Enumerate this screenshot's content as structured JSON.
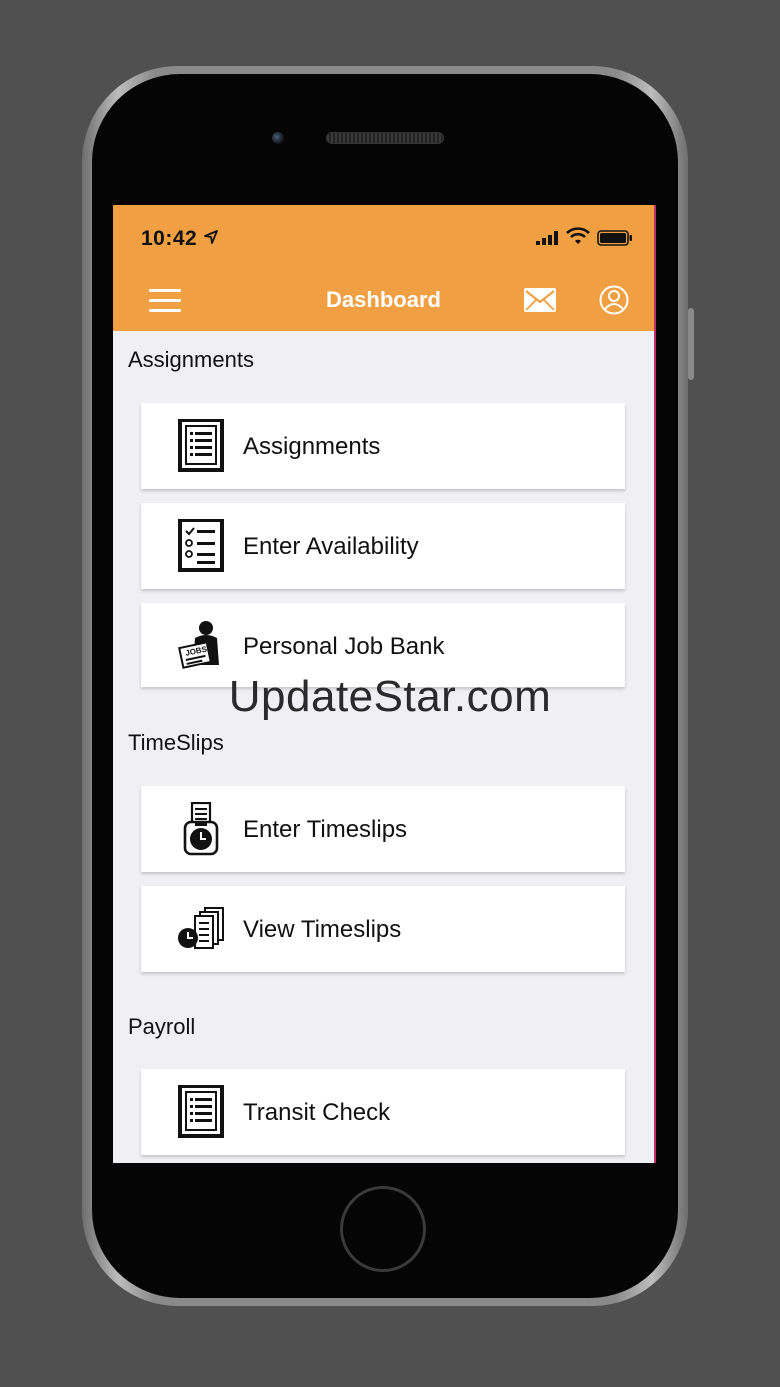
{
  "status_bar": {
    "time": "10:42"
  },
  "nav": {
    "title": "Dashboard"
  },
  "sections": [
    {
      "title": "Assignments",
      "items": [
        {
          "label": "Assignments",
          "icon": "document-list-icon"
        },
        {
          "label": "Enter Availability",
          "icon": "checklist-icon"
        },
        {
          "label": "Personal Job Bank",
          "icon": "person-jobs-icon"
        }
      ]
    },
    {
      "title": "TimeSlips",
      "items": [
        {
          "label": "Enter Timeslips",
          "icon": "timeslip-clock-icon"
        },
        {
          "label": "View Timeslips",
          "icon": "stacked-timeslips-icon"
        }
      ]
    },
    {
      "title": "Payroll",
      "items": [
        {
          "label": "Transit Check",
          "icon": "document-list-icon"
        }
      ]
    }
  ],
  "watermark": "UpdateStar.com",
  "colors": {
    "accent": "#f0a043",
    "background": "#efeff4",
    "card": "#ffffff",
    "backdrop": "#505050"
  }
}
